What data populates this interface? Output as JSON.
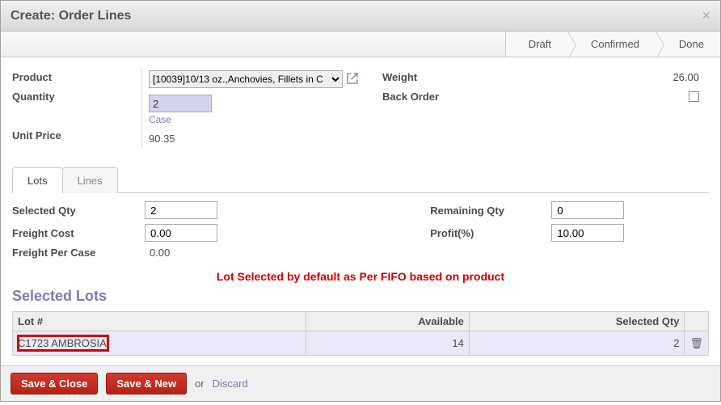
{
  "dialog": {
    "title": "Create: Order Lines"
  },
  "status_steps": [
    "Draft",
    "Confirmed",
    "Done"
  ],
  "fields": {
    "product_label": "Product",
    "product_value": "[10039]10/13 oz.,Anchovies, Fillets in C",
    "quantity_label": "Quantity",
    "quantity_value": "2",
    "quantity_uom": "Case",
    "unit_price_label": "Unit Price",
    "unit_price_value": "90.35",
    "weight_label": "Weight",
    "weight_value": "26.00",
    "back_order_label": "Back Order",
    "back_order_checked": false
  },
  "tabs": {
    "lots": "Lots",
    "lines": "Lines",
    "active": "lots"
  },
  "lot_panel": {
    "selected_qty_label": "Selected Qty",
    "selected_qty_value": "2",
    "remaining_qty_label": "Remaining Qty",
    "remaining_qty_value": "0",
    "freight_cost_label": "Freight Cost",
    "freight_cost_value": "0.00",
    "profit_label": "Profit(%)",
    "profit_value": "10.00",
    "freight_per_case_label": "Freight Per Case",
    "freight_per_case_value": "0.00"
  },
  "annotation": "Lot Selected by default as Per FIFO based on product",
  "selected_lots_heading": "Selected Lots",
  "lots_table": {
    "columns": {
      "lot": "Lot #",
      "available": "Available",
      "selected": "Selected Qty"
    },
    "rows": [
      {
        "lot": "C1723 AMBROSIA",
        "available": "14",
        "selected": "2"
      }
    ]
  },
  "footer": {
    "save_close": "Save & Close",
    "save_new": "Save & New",
    "or": "or",
    "discard": "Discard"
  }
}
